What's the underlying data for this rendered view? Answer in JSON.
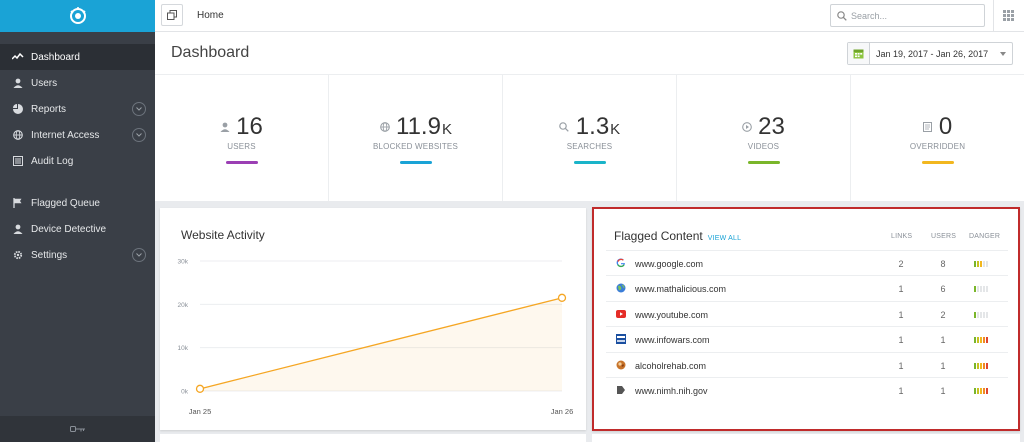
{
  "sidebar": {
    "items": [
      {
        "label": "Dashboard",
        "icon": "activity-icon",
        "active": true
      },
      {
        "label": "Users",
        "icon": "user-icon"
      },
      {
        "label": "Reports",
        "icon": "pie-chart-icon",
        "expandable": true
      },
      {
        "label": "Internet Access",
        "icon": "globe-icon",
        "expandable": true
      },
      {
        "label": "Audit Log",
        "icon": "list-icon"
      }
    ],
    "items2": [
      {
        "label": "Flagged Queue",
        "icon": "flag-icon"
      },
      {
        "label": "Device Detective",
        "icon": "user-icon"
      },
      {
        "label": "Settings",
        "icon": "gear-icon",
        "expandable": true
      }
    ]
  },
  "topbar": {
    "breadcrumb": "Home",
    "search_placeholder": "Search..."
  },
  "page": {
    "title": "Dashboard",
    "date_range": "Jan 19, 2017 - Jan 26, 2017"
  },
  "stats": [
    {
      "value": "16",
      "suffix": "",
      "label": "USERS",
      "color": "#9b3fb4",
      "icon": "user-icon"
    },
    {
      "value": "11.9",
      "suffix": "K",
      "label": "BLOCKED WEBSITES",
      "color": "#1aa3d6",
      "icon": "globe-icon"
    },
    {
      "value": "1.3",
      "suffix": "K",
      "label": "SEARCHES",
      "color": "#1ab4c9",
      "icon": "search-icon"
    },
    {
      "value": "23",
      "suffix": "",
      "label": "VIDEOS",
      "color": "#7ab62a",
      "icon": "play-icon"
    },
    {
      "value": "0",
      "suffix": "",
      "label": "OVERRIDDEN",
      "color": "#f2b71f",
      "icon": "document-icon"
    }
  ],
  "website_activity": {
    "title": "Website Activity"
  },
  "chart_data": {
    "type": "area",
    "x": [
      "Jan 25",
      "Jan 26"
    ],
    "values": [
      500,
      21500
    ],
    "yticks": [
      "0k",
      "10k",
      "20k",
      "30k"
    ],
    "ylim": [
      0,
      30000
    ],
    "grid": true,
    "color": "#f5a623"
  },
  "flagged": {
    "title": "Flagged Content",
    "view_all": "VIEW ALL",
    "col_links": "LINKS",
    "col_users": "USERS",
    "col_danger": "DANGER",
    "rows": [
      {
        "site": "www.google.com",
        "links": "2",
        "users": "8",
        "danger": 3,
        "icon": "google-icon"
      },
      {
        "site": "www.mathalicious.com",
        "links": "1",
        "users": "6",
        "danger": 1,
        "icon": "globe-icon"
      },
      {
        "site": "www.youtube.com",
        "links": "1",
        "users": "2",
        "danger": 1,
        "icon": "youtube-icon"
      },
      {
        "site": "www.infowars.com",
        "links": "1",
        "users": "1",
        "danger": 5,
        "icon": "infowars-icon"
      },
      {
        "site": "alcoholrehab.com",
        "links": "1",
        "users": "1",
        "danger": 5,
        "icon": "rehab-icon"
      },
      {
        "site": "www.nimh.nih.gov",
        "links": "1",
        "users": "1",
        "danger": 5,
        "icon": "nih-icon"
      }
    ]
  }
}
